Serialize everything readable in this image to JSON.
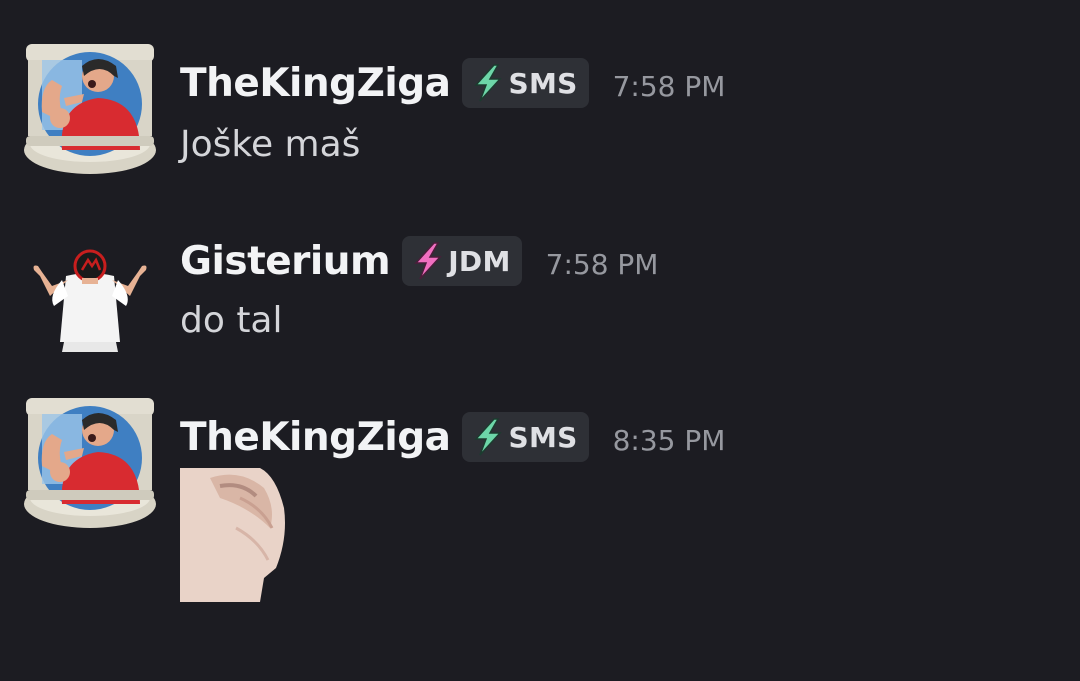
{
  "theme": {
    "background": "#1c1c22",
    "username_color": "#f2f3f5",
    "message_color": "#d4d5d9",
    "timestamp_color": "#96989f",
    "tag_background": "#2e3036",
    "sms_bolt_color": "#6dd6a8",
    "jdm_bolt_color": "#f06fc0"
  },
  "messages": [
    {
      "author": "TheKingZiga",
      "avatar_icon": "toilet-avatar-icon",
      "tag": {
        "label": "SMS",
        "icon": "lightning-bolt-icon"
      },
      "timestamp": "7:58 PM",
      "text": "Joške maš"
    },
    {
      "author": "Gisterium",
      "avatar_icon": "flexing-man-avatar-icon",
      "tag": {
        "label": "JDM",
        "icon": "lightning-bolt-icon"
      },
      "timestamp": "7:58 PM",
      "text": "do tal"
    },
    {
      "author": "TheKingZiga",
      "avatar_icon": "toilet-avatar-icon",
      "tag": {
        "label": "SMS",
        "icon": "lightning-bolt-icon"
      },
      "timestamp": "8:35 PM",
      "attachment": "cat-sticker-image"
    }
  ]
}
